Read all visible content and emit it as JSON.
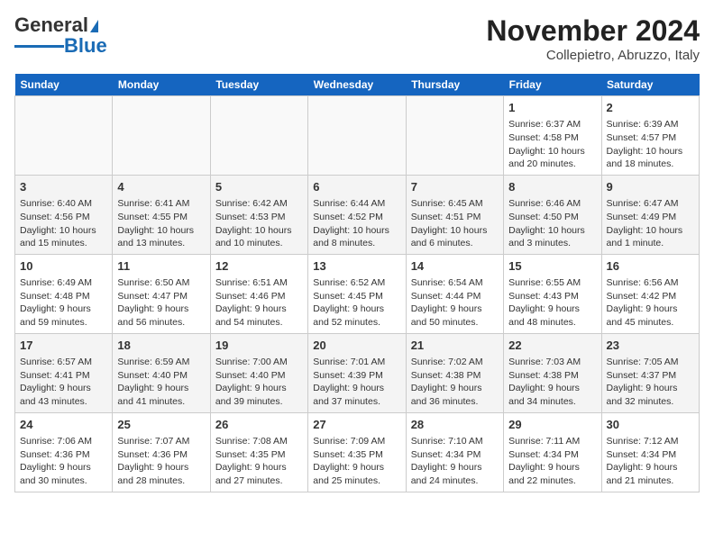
{
  "header": {
    "logo_line1": "General",
    "logo_line2": "Blue",
    "month": "November 2024",
    "location": "Collepietro, Abruzzo, Italy"
  },
  "days_of_week": [
    "Sunday",
    "Monday",
    "Tuesday",
    "Wednesday",
    "Thursday",
    "Friday",
    "Saturday"
  ],
  "weeks": [
    [
      {
        "day": "",
        "info": ""
      },
      {
        "day": "",
        "info": ""
      },
      {
        "day": "",
        "info": ""
      },
      {
        "day": "",
        "info": ""
      },
      {
        "day": "",
        "info": ""
      },
      {
        "day": "1",
        "info": "Sunrise: 6:37 AM\nSunset: 4:58 PM\nDaylight: 10 hours and 20 minutes."
      },
      {
        "day": "2",
        "info": "Sunrise: 6:39 AM\nSunset: 4:57 PM\nDaylight: 10 hours and 18 minutes."
      }
    ],
    [
      {
        "day": "3",
        "info": "Sunrise: 6:40 AM\nSunset: 4:56 PM\nDaylight: 10 hours and 15 minutes."
      },
      {
        "day": "4",
        "info": "Sunrise: 6:41 AM\nSunset: 4:55 PM\nDaylight: 10 hours and 13 minutes."
      },
      {
        "day": "5",
        "info": "Sunrise: 6:42 AM\nSunset: 4:53 PM\nDaylight: 10 hours and 10 minutes."
      },
      {
        "day": "6",
        "info": "Sunrise: 6:44 AM\nSunset: 4:52 PM\nDaylight: 10 hours and 8 minutes."
      },
      {
        "day": "7",
        "info": "Sunrise: 6:45 AM\nSunset: 4:51 PM\nDaylight: 10 hours and 6 minutes."
      },
      {
        "day": "8",
        "info": "Sunrise: 6:46 AM\nSunset: 4:50 PM\nDaylight: 10 hours and 3 minutes."
      },
      {
        "day": "9",
        "info": "Sunrise: 6:47 AM\nSunset: 4:49 PM\nDaylight: 10 hours and 1 minute."
      }
    ],
    [
      {
        "day": "10",
        "info": "Sunrise: 6:49 AM\nSunset: 4:48 PM\nDaylight: 9 hours and 59 minutes."
      },
      {
        "day": "11",
        "info": "Sunrise: 6:50 AM\nSunset: 4:47 PM\nDaylight: 9 hours and 56 minutes."
      },
      {
        "day": "12",
        "info": "Sunrise: 6:51 AM\nSunset: 4:46 PM\nDaylight: 9 hours and 54 minutes."
      },
      {
        "day": "13",
        "info": "Sunrise: 6:52 AM\nSunset: 4:45 PM\nDaylight: 9 hours and 52 minutes."
      },
      {
        "day": "14",
        "info": "Sunrise: 6:54 AM\nSunset: 4:44 PM\nDaylight: 9 hours and 50 minutes."
      },
      {
        "day": "15",
        "info": "Sunrise: 6:55 AM\nSunset: 4:43 PM\nDaylight: 9 hours and 48 minutes."
      },
      {
        "day": "16",
        "info": "Sunrise: 6:56 AM\nSunset: 4:42 PM\nDaylight: 9 hours and 45 minutes."
      }
    ],
    [
      {
        "day": "17",
        "info": "Sunrise: 6:57 AM\nSunset: 4:41 PM\nDaylight: 9 hours and 43 minutes."
      },
      {
        "day": "18",
        "info": "Sunrise: 6:59 AM\nSunset: 4:40 PM\nDaylight: 9 hours and 41 minutes."
      },
      {
        "day": "19",
        "info": "Sunrise: 7:00 AM\nSunset: 4:40 PM\nDaylight: 9 hours and 39 minutes."
      },
      {
        "day": "20",
        "info": "Sunrise: 7:01 AM\nSunset: 4:39 PM\nDaylight: 9 hours and 37 minutes."
      },
      {
        "day": "21",
        "info": "Sunrise: 7:02 AM\nSunset: 4:38 PM\nDaylight: 9 hours and 36 minutes."
      },
      {
        "day": "22",
        "info": "Sunrise: 7:03 AM\nSunset: 4:38 PM\nDaylight: 9 hours and 34 minutes."
      },
      {
        "day": "23",
        "info": "Sunrise: 7:05 AM\nSunset: 4:37 PM\nDaylight: 9 hours and 32 minutes."
      }
    ],
    [
      {
        "day": "24",
        "info": "Sunrise: 7:06 AM\nSunset: 4:36 PM\nDaylight: 9 hours and 30 minutes."
      },
      {
        "day": "25",
        "info": "Sunrise: 7:07 AM\nSunset: 4:36 PM\nDaylight: 9 hours and 28 minutes."
      },
      {
        "day": "26",
        "info": "Sunrise: 7:08 AM\nSunset: 4:35 PM\nDaylight: 9 hours and 27 minutes."
      },
      {
        "day": "27",
        "info": "Sunrise: 7:09 AM\nSunset: 4:35 PM\nDaylight: 9 hours and 25 minutes."
      },
      {
        "day": "28",
        "info": "Sunrise: 7:10 AM\nSunset: 4:34 PM\nDaylight: 9 hours and 24 minutes."
      },
      {
        "day": "29",
        "info": "Sunrise: 7:11 AM\nSunset: 4:34 PM\nDaylight: 9 hours and 22 minutes."
      },
      {
        "day": "30",
        "info": "Sunrise: 7:12 AM\nSunset: 4:34 PM\nDaylight: 9 hours and 21 minutes."
      }
    ]
  ]
}
